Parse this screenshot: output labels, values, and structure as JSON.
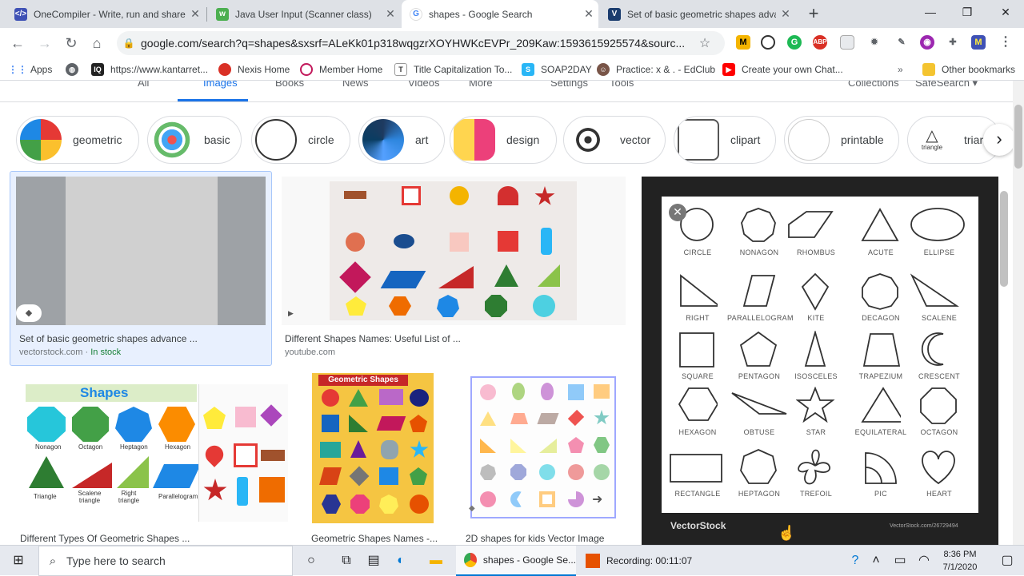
{
  "browser": {
    "tabs": [
      {
        "title": "OneCompiler - Write, run and share",
        "fav_color": "#3f51b5",
        "fav_text": "</>"
      },
      {
        "title": "Java User Input (Scanner class)",
        "fav_color": "#4caf50",
        "fav_text": "w"
      },
      {
        "title": "shapes - Google Search",
        "fav_color": "#4285f4",
        "fav_text": "G"
      },
      {
        "title": "Set of basic geometric shapes advan",
        "fav_color": "#1a3c6e",
        "fav_text": "V"
      }
    ],
    "url": "google.com/search?q=shapes&sxsrf=ALeKk01p318wqgzrXOYHWKcEVPr_209Kaw:1593615925574&sourc...",
    "bookmarks": [
      {
        "label": "Apps",
        "icon": "apps-grid-icon",
        "color": "#4285f4"
      },
      {
        "label": "",
        "icon": "globe-icon",
        "color": "#5f6368"
      },
      {
        "label": "https://www.kantarret...",
        "icon": "kantar-icon",
        "color": "#222"
      },
      {
        "label": "Nexis Home",
        "icon": "nexis-icon",
        "color": "#d93025"
      },
      {
        "label": "Member Home",
        "icon": "member-icon",
        "color": "#c2185b"
      },
      {
        "label": "Title Capitalization To...",
        "icon": "title-cap-icon",
        "color": "#5f6368"
      },
      {
        "label": "SOAP2DAY",
        "icon": "soap-icon",
        "color": "#29b6f6"
      },
      {
        "label": "Practice: x & . - EdClub",
        "icon": "edclub-icon",
        "color": "#795548"
      },
      {
        "label": "Create your own Chat...",
        "icon": "youtube-icon",
        "color": "#ff0000"
      }
    ],
    "other_bookmarks": "Other bookmarks",
    "overflow": "»"
  },
  "gnav": {
    "all": "All",
    "images": "Images",
    "books": "Books",
    "news": "News",
    "videos": "Videos",
    "more": "More",
    "settings": "Settings",
    "tools": "Tools",
    "collections": "Collections",
    "safesearch": "SafeSearch ▾"
  },
  "chips": [
    {
      "label": "geometric"
    },
    {
      "label": "basic"
    },
    {
      "label": "circle"
    },
    {
      "label": "art"
    },
    {
      "label": "design"
    },
    {
      "label": "vector"
    },
    {
      "label": "clipart"
    },
    {
      "label": "printable"
    },
    {
      "label": "triar",
      "sub": "triangle"
    }
  ],
  "results": [
    {
      "title": "Set of basic geometric shapes advance ...",
      "source": "vectorstock.com",
      "stock": "In stock"
    },
    {
      "title": "Different Shapes Names: Useful List of ...",
      "source": "youtube.com"
    },
    {
      "title": "Different Types Of Geometric Shapes ...",
      "source": ""
    },
    {
      "title": "Geometric Shapes Names -...",
      "source": ""
    },
    {
      "title": "2D shapes for kids Vector Image",
      "source": ""
    }
  ],
  "thumb_labels": {
    "shapes_banner": "Shapes",
    "geo_banner": "Geometric Shapes",
    "shapes_list": [
      "Nonagon",
      "Octagon",
      "Heptagon",
      "Hexagon",
      "Triangle",
      "Scalene triangle",
      "Right triangle",
      "Parallelogram"
    ]
  },
  "preview": {
    "labels": [
      "CIRCLE",
      "NONAGON",
      "RHOMBUS",
      "ACUTE",
      "ELLIPSE",
      "RIGHT",
      "PARALLELOGRAM",
      "KITE",
      "DECAGON",
      "SCALENE",
      "SQUARE",
      "PENTAGON",
      "ISOSCELES",
      "TRAPEZIUM",
      "CRESCENT",
      "HEXAGON",
      "OBTUSE",
      "STAR",
      "EQUILATERAL",
      "OCTAGON",
      "RECTANGLE",
      "HEPTAGON",
      "TREFOIL",
      "PIC",
      "HEART"
    ],
    "brand": "VectorStock",
    "footer_id": "VectorStock.com/26729494",
    "close": "✕"
  },
  "taskbar": {
    "search_placeholder": "Type here to search",
    "chrome_app": "shapes - Google Se...",
    "recording": "Recording:  00:11:07",
    "time": "8:36 PM",
    "date": "7/1/2020"
  }
}
